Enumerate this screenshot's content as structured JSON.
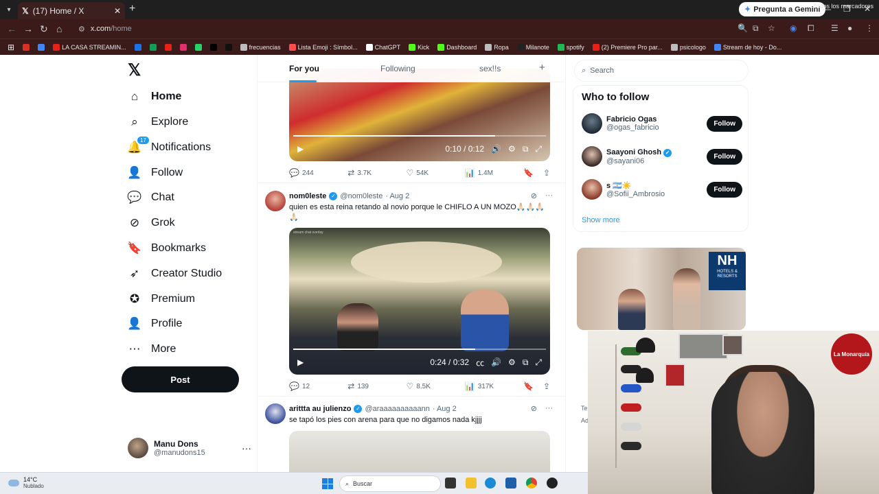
{
  "browser": {
    "tab_title": "(17) Home / X",
    "url_domain": "x.com",
    "url_path": "/home",
    "gemini_button": "Pregunta a Gemini",
    "bookmarks": [
      {
        "label": "",
        "color": "#d93025"
      },
      {
        "label": "",
        "color": "#4285f4"
      },
      {
        "label": "LA CASA STREAMIN...",
        "color": "#e62117"
      },
      {
        "label": "",
        "color": "#1a73e8"
      },
      {
        "label": "",
        "color": "#0f9d58"
      },
      {
        "label": "",
        "color": "#e62117"
      },
      {
        "label": "",
        "color": "#e1306c"
      },
      {
        "label": "",
        "color": "#25d366"
      },
      {
        "label": "",
        "color": "#000000"
      },
      {
        "label": "",
        "color": "#111111"
      },
      {
        "label": "frecuencias",
        "color": "#bdbdbd"
      },
      {
        "label": "Lista Emoji : Símbol...",
        "color": "#ff4d4d"
      },
      {
        "label": "ChatGPT",
        "color": "#ffffff"
      },
      {
        "label": "Kick",
        "color": "#53fc18"
      },
      {
        "label": "Dashboard",
        "color": "#53fc18"
      },
      {
        "label": "Ropa",
        "color": "#bdbdbd"
      },
      {
        "label": "Milanote",
        "color": "#222222"
      },
      {
        "label": "spotify",
        "color": "#1db954"
      },
      {
        "label": "(2) Premiere Pro par...",
        "color": "#e62117"
      },
      {
        "label": "psicologo",
        "color": "#bdbdbd"
      },
      {
        "label": "Stream de hoy - Do...",
        "color": "#4285f4"
      }
    ],
    "bookmarks_right": "Todos los marcadores"
  },
  "leftnav": {
    "items": [
      {
        "label": "Home",
        "icon": "home-icon",
        "glyph": "⌂"
      },
      {
        "label": "Explore",
        "icon": "search-icon",
        "glyph": "⌕"
      },
      {
        "label": "Notifications",
        "icon": "bell-icon",
        "glyph": "🔔"
      },
      {
        "label": "Follow",
        "icon": "person-plus-icon",
        "glyph": "👤"
      },
      {
        "label": "Chat",
        "icon": "chat-icon",
        "glyph": "💬"
      },
      {
        "label": "Grok",
        "icon": "grok-icon",
        "glyph": "⊘"
      },
      {
        "label": "Bookmarks",
        "icon": "bookmark-icon",
        "glyph": "🔖"
      },
      {
        "label": "Creator Studio",
        "icon": "rocket-icon",
        "glyph": "➶"
      },
      {
        "label": "Premium",
        "icon": "verified-icon",
        "glyph": "✪"
      },
      {
        "label": "Profile",
        "icon": "person-icon",
        "glyph": "👤"
      },
      {
        "label": "More",
        "icon": "more-circle-icon",
        "glyph": "⋯"
      }
    ],
    "notif_count": "17",
    "post_button": "Post",
    "account": {
      "name": "Manu Dons",
      "handle": "@manudons15"
    }
  },
  "feed": {
    "tabs": [
      "For you",
      "Following",
      "sex!!s"
    ],
    "tweet1": {
      "video_time": "0:10 / 0:12",
      "progress": 0.8,
      "replies": "244",
      "reposts": "3.7K",
      "likes": "54K",
      "views": "1.4M"
    },
    "tweet2": {
      "name": "nom0leste",
      "handle": "@nom0leste",
      "date": "· Aug 2",
      "text": "quien es esta reina retando al novio porque le CHIFLO A UN MOZO🙏🏻🙏🏻🙏🏻🙏🏻",
      "video_time": "0:24 / 0:32",
      "progress": 0.72,
      "replies": "12",
      "reposts": "139",
      "likes": "8.5K",
      "views": "317K"
    },
    "tweet3": {
      "name": "arittta au julienzo",
      "handle": "@araaaaaaaaaann",
      "date": "· Aug 2",
      "text": "se tapó los pies con arena para que no digamos nada kjjjj"
    }
  },
  "sidebar": {
    "search_placeholder": "Search",
    "who_to_follow_title": "Who to follow",
    "suggestions": [
      {
        "name": "Fabricio Ogas",
        "handle": "@ogas_fabricio",
        "verified": false,
        "follow": "Follow"
      },
      {
        "name": "Saayoni Ghosh",
        "handle": "@sayani06",
        "verified": true,
        "follow": "Follow"
      },
      {
        "name": "s 🇦🇷☀️",
        "handle": "@Sofii_Ambrosio",
        "verified": false,
        "follow": "Follow"
      }
    ],
    "show_more": "Show more",
    "ad_brand_big": "NH",
    "ad_brand_small": "HOTELS & RESORTS",
    "ad_sub1": "Te",
    "ad_sub2": "Ad"
  },
  "webcam": {
    "badge_text": "La Monarquía"
  },
  "taskbar": {
    "temperature": "14°C",
    "condition": "Nublado",
    "search_placeholder": "Buscar"
  }
}
